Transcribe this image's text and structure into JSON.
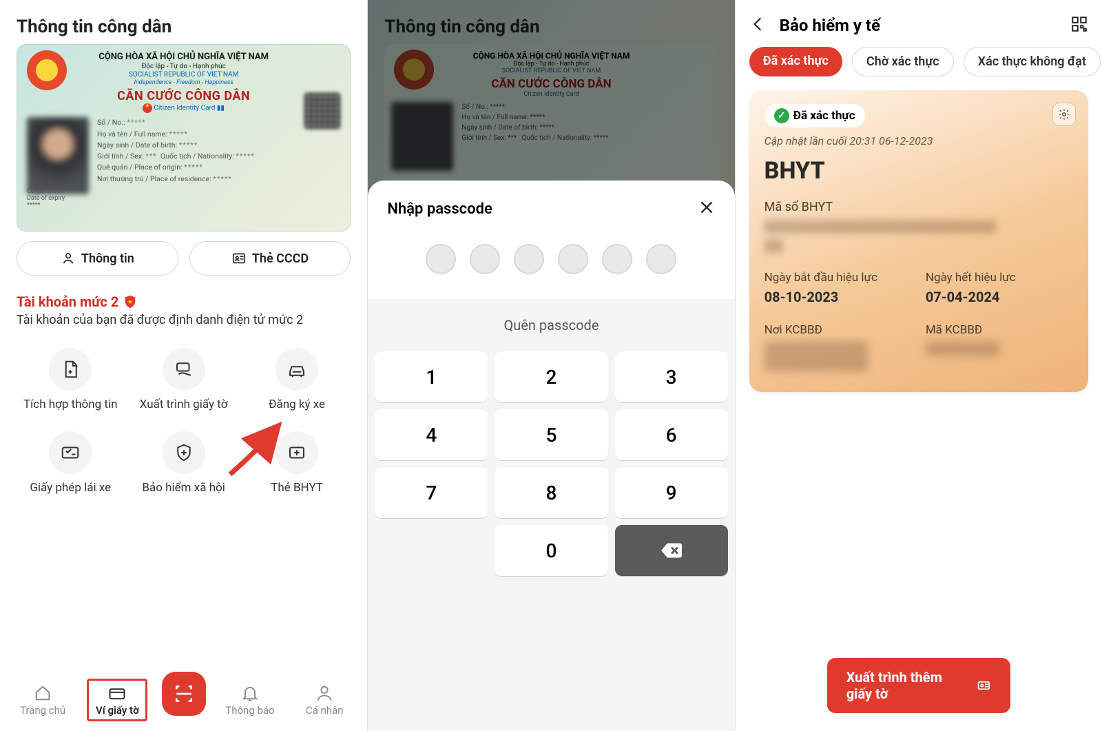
{
  "panel1": {
    "header": "Thông tin công dân",
    "id_card": {
      "country_line": "CỘNG HÒA XÃ HỘI CHỦ NGHĨA VIỆT NAM",
      "motto": "Độc lập - Tự do - Hạnh phúc",
      "country_en": "SOCIALIST REPUBLIC OF VIET NAM",
      "motto_en": "Independence - Freedom - Happiness",
      "title": "CĂN CƯỚC CÔNG DÂN",
      "subtitle": "Citizen Identity Card",
      "fields": {
        "so": "Số / No.:",
        "hoten": "Họ và tên / Full name:",
        "ngaysinh": "Ngày sinh / Date of birth:",
        "gioitinh": "Giới tính / Sex:",
        "quoctich": "Quốc tịch / Nationality:",
        "quequan": "Quê quán / Place of origin:",
        "thuongtru": "Nơi thường trú / Place of residence:"
      },
      "expiry_vn": "Có giá trị đến:",
      "expiry_en": "Date of expiry"
    },
    "buttons": {
      "info": "Thông tin",
      "cccd": "Thẻ CCCD"
    },
    "level_title": "Tài khoản mức 2",
    "level_desc": "Tài khoản của bạn đã được định danh điện tử mức 2",
    "grid": [
      "Tích hợp thông tin",
      "Xuất trình giấy tờ",
      "Đăng ký xe",
      "Giấy phép lái xe",
      "Bảo hiểm xã hội",
      "Thẻ BHYT"
    ],
    "nav": {
      "home": "Trang chủ",
      "wallet": "Ví giấy tờ",
      "notif": "Thông báo",
      "profile": "Cá nhân"
    }
  },
  "panel2": {
    "header": "Thông tin công dân",
    "sheet_title": "Nhập passcode",
    "forgot": "Quên passcode",
    "keys": [
      "1",
      "2",
      "3",
      "4",
      "5",
      "6",
      "7",
      "8",
      "9",
      "",
      "0",
      "del"
    ]
  },
  "panel3": {
    "title": "Bảo hiểm y tế",
    "tabs": {
      "active": "Đã xác thực",
      "t2": "Chờ xác thực",
      "t3": "Xác thực không đạt"
    },
    "card": {
      "verified": "Đã xác thực",
      "updated": "Cập nhật lần cuối 20:31 06-12-2023",
      "title": "BHYT",
      "code_label": "Mã số BHYT",
      "col1_label": "Ngày bắt đầu hiệu lực",
      "col1_value": "08-10-2023",
      "col2_label": "Ngày hết hiệu lực",
      "col2_value": "07-04-2024",
      "col3_label": "Nơi KCBBĐ",
      "col4_label": "Mã KCBBĐ"
    },
    "cta": "Xuất trình thêm giấy tờ"
  }
}
